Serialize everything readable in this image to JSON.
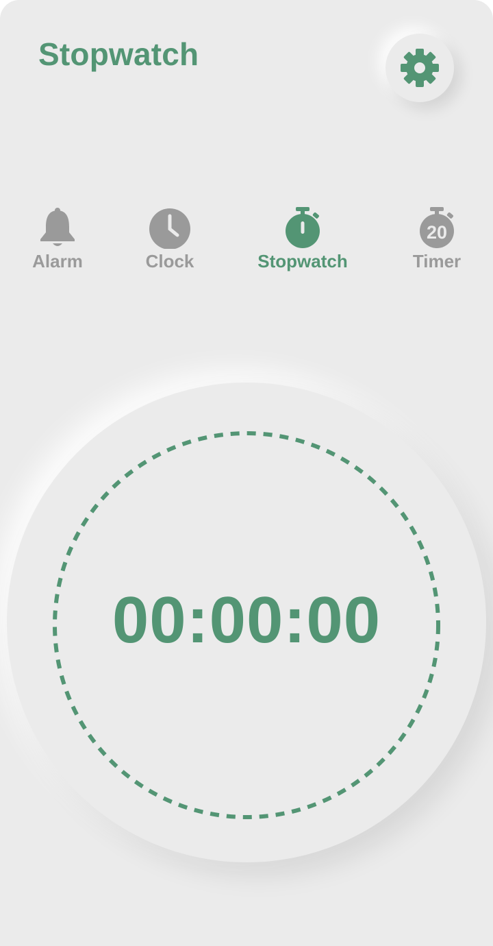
{
  "header": {
    "title": "Stopwatch",
    "settings_icon": "gear-icon"
  },
  "nav": {
    "active": "Stopwatch",
    "items": [
      {
        "label": "Alarm",
        "icon": "bell-icon"
      },
      {
        "label": "Clock",
        "icon": "clock-icon"
      },
      {
        "label": "Stopwatch",
        "icon": "stopwatch-icon"
      },
      {
        "label": "Timer",
        "icon": "timer-icon",
        "icon_text": "20"
      }
    ]
  },
  "stopwatch": {
    "display": "00:00:00"
  },
  "colors": {
    "accent": "#539574",
    "inactive": "#9a9a9a",
    "background": "#ebebeb"
  }
}
